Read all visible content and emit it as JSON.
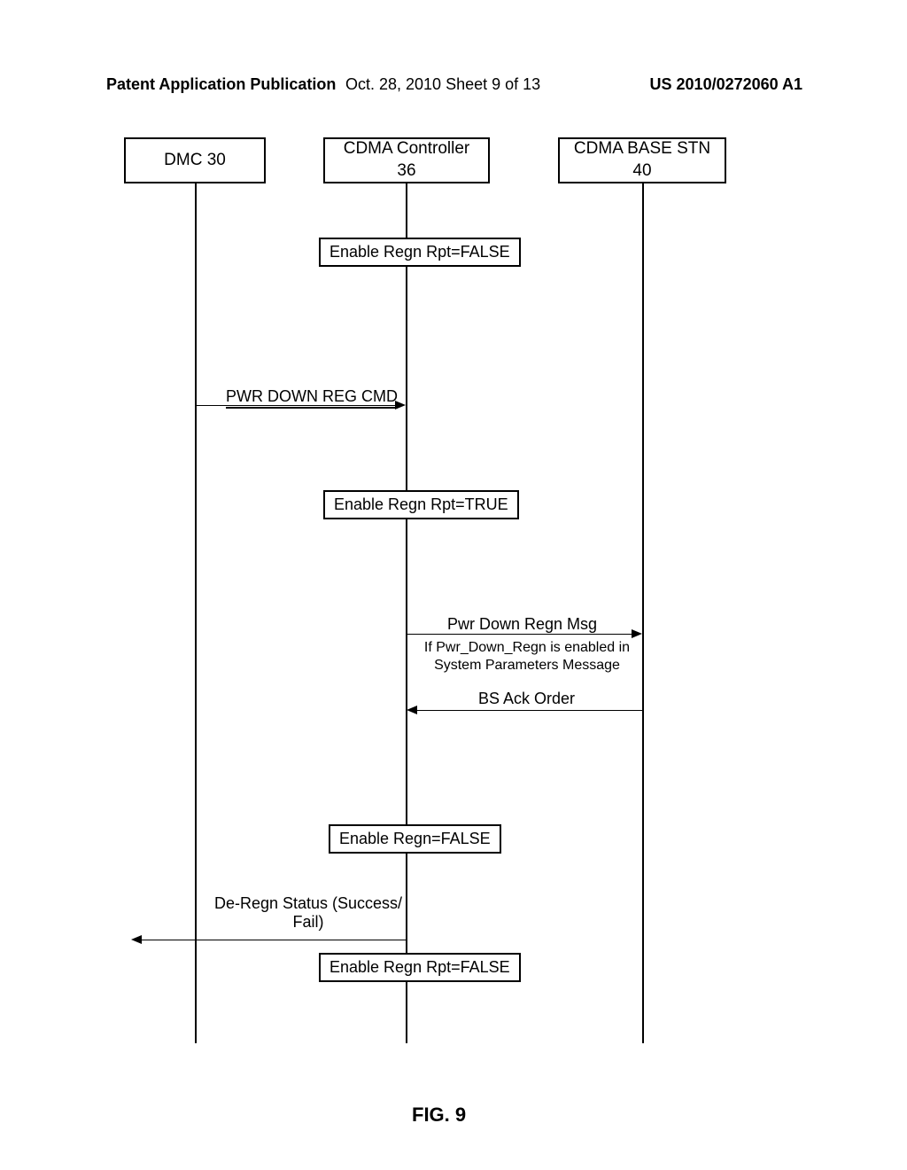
{
  "header": {
    "left": "Patent Application Publication",
    "center": "Oct. 28, 2010   Sheet 9 of 13",
    "right": "US 2010/0272060 A1"
  },
  "actors": {
    "dmc": {
      "line1": "DMC 30"
    },
    "controller": {
      "line1": "CDMA Controller",
      "line2": "36"
    },
    "base": {
      "line1": "CDMA BASE STN",
      "line2": "40"
    }
  },
  "states": {
    "s1": "Enable Regn Rpt=FALSE",
    "s2": "Enable Regn Rpt=TRUE",
    "s3": "Enable Regn=FALSE",
    "s4": "Enable Regn Rpt=FALSE"
  },
  "messages": {
    "pwrDownCmd": "PWR DOWN REG CMD",
    "pwrDownMsg": "Pwr Down Regn Msg",
    "bsAck": "BS Ack Order",
    "deRegn": {
      "line1": "De-Regn Status (Success/",
      "line2": "Fail)"
    }
  },
  "notes": {
    "cond": {
      "line1": "If Pwr_Down_Regn is enabled in",
      "line2": "System Parameters Message"
    }
  },
  "figure": "FIG. 9"
}
